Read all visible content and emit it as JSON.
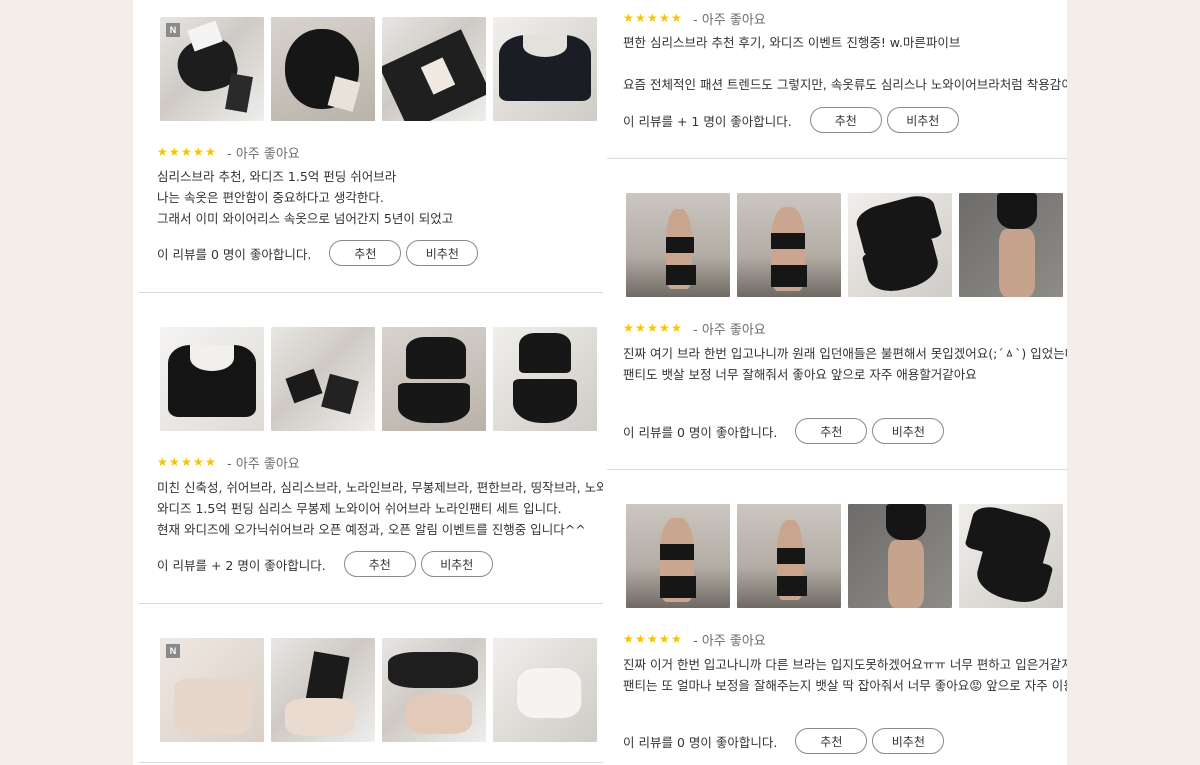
{
  "rating_text": "- 아주 좋아요",
  "buttons": {
    "recommend": "추천",
    "not_recommend": "비추천"
  },
  "left_reviews": [
    {
      "badge": "N",
      "lines": [
        "심리스브라 추천, 와디즈 1.5억 펀딩 쉬어브라",
        "나는 속옷은 편안함이 중요하다고 생각한다.",
        "그래서 이미 와이어리스 속옷으로 넘어간지 5년이 되었고"
      ],
      "likes": "이 리뷰를 0 명이 좋아합니다."
    },
    {
      "lines": [
        "미친 신축성, 쉬어브라, 심리스브라, 노라인브라, 무봉제브라, 편한브라, 띵작브라, 노와",
        "와디즈 1.5억 펀딩 심리스 무봉제 노와이어 쉬어브라 노라인팬티 세트 입니다.",
        "현재 와디즈에 오가닉쉬어브라 오픈 예정과, 오픈 알림 이벤트를 진행중 입니다^^"
      ],
      "likes": "이 리뷰를 + 2 명이 좋아합니다."
    },
    {
      "badge": "N"
    }
  ],
  "right_reviews": [
    {
      "lines": [
        "편한 심리스브라 추천 후기, 와디즈 이벤트 진행중! w.마른파이브",
        "",
        "요즘 전체적인 패션 트렌드도 그렇지만, 속옷류도 심리스나 노와이어브라처럼 착용감이"
      ],
      "likes": "이 리뷰를 + 1 명이 좋아합니다."
    },
    {
      "lines": [
        "진짜 여기 브라 한번 입고나니까 원래 입던애들은 불편해서 못입겠어요(;´ㅿ`) 입었는데",
        "팬티도 뱃살 보정 너무 잘해줘서 좋아요 앞으로 자주 애용할거같아요"
      ],
      "likes": "이 리뷰를 0 명이 좋아합니다."
    },
    {
      "lines": [
        "진짜 이거 한번 입고나니까 다른 브라는 입지도못하겠어요ㅠㅠ 너무 편하고 입은거같지",
        "팬티는 또 얼마나 보정을 잘해주는지 뱃살 딱 잡아줘서 너무 좋아요😡 앞으로 자주 이용"
      ],
      "likes": "이 리뷰를 0 명이 좋아합니다."
    }
  ],
  "colors": {
    "star": "#f6c400",
    "page_bg": "#f3eee9"
  }
}
